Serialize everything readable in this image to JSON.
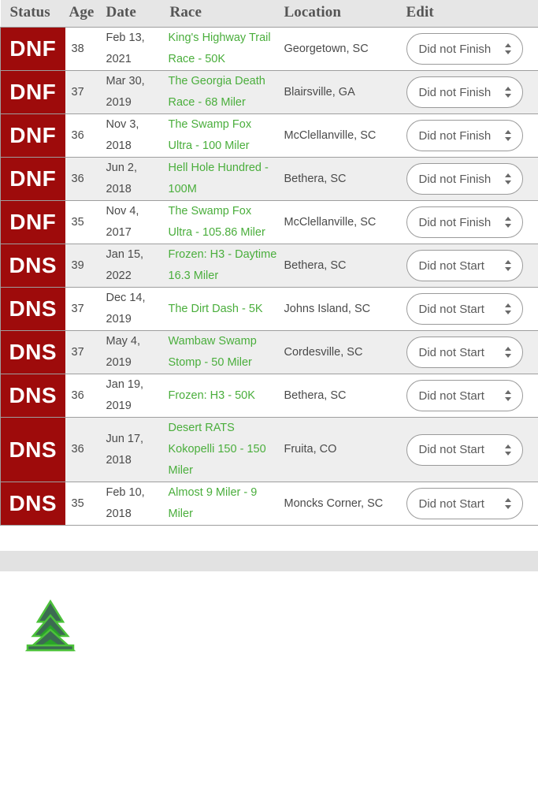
{
  "table": {
    "columns": [
      "Status",
      "Age",
      "Date",
      "Race",
      "Location",
      "Edit"
    ],
    "rows": [
      {
        "status": "DNF",
        "age": "38",
        "date_line1": "Feb 13,",
        "date_line2": "2021",
        "race": "King's Highway Trail Race - 50K",
        "location": "Georgetown, SC",
        "edit_value": "Did not Finish"
      },
      {
        "status": "DNF",
        "age": "37",
        "date_line1": "Mar 30,",
        "date_line2": "2019",
        "race": "The Georgia Death Race - 68 Miler",
        "location": "Blairsville, GA",
        "edit_value": "Did not Finish"
      },
      {
        "status": "DNF",
        "age": "36",
        "date_line1": "Nov 3,",
        "date_line2": "2018",
        "race": "The Swamp Fox Ultra - 100 Miler",
        "location": "McClellanville, SC",
        "edit_value": "Did not Finish"
      },
      {
        "status": "DNF",
        "age": "36",
        "date_line1": "Jun 2,",
        "date_line2": "2018",
        "race": "Hell Hole Hundred - 100M",
        "location": "Bethera, SC",
        "edit_value": "Did not Finish"
      },
      {
        "status": "DNF",
        "age": "35",
        "date_line1": "Nov 4,",
        "date_line2": "2017",
        "race": "The Swamp Fox Ultra - 105.86 Miler",
        "location": "McClellanville, SC",
        "edit_value": "Did not Finish"
      },
      {
        "status": "DNS",
        "age": "39",
        "date_line1": "Jan 15,",
        "date_line2": "2022",
        "race": "Frozen: H3 - Daytime 16.3 Miler",
        "location": "Bethera, SC",
        "edit_value": "Did not Start"
      },
      {
        "status": "DNS",
        "age": "37",
        "date_line1": "Dec 14,",
        "date_line2": "2019",
        "race": "The Dirt Dash - 5K",
        "location": "Johns Island, SC",
        "edit_value": "Did not Start"
      },
      {
        "status": "DNS",
        "age": "37",
        "date_line1": "May 4,",
        "date_line2": "2019",
        "race": "Wambaw Swamp Stomp - 50 Miler",
        "location": "Cordesville, SC",
        "edit_value": "Did not Start"
      },
      {
        "status": "DNS",
        "age": "36",
        "date_line1": "Jan 19,",
        "date_line2": "2019",
        "race": "Frozen: H3 - 50K",
        "location": "Bethera, SC",
        "edit_value": "Did not Start"
      },
      {
        "status": "DNS",
        "age": "36",
        "date_line1": "Jun 17,",
        "date_line2": "2018",
        "race": "Desert RATS Kokopelli 150 - 150 Miler",
        "location": "Fruita, CO",
        "edit_value": "Did not Start"
      },
      {
        "status": "DNS",
        "age": "35",
        "date_line1": "Feb 10,",
        "date_line2": "2018",
        "race": "Almost 9 Miler - 9 Miler",
        "location": "Moncks Corner, SC",
        "edit_value": "Did not Start"
      }
    ]
  },
  "footer": {
    "logo_name": "pine-tree-logo"
  },
  "colors": {
    "status_red": "#9e0b0b",
    "race_link_green": "#4aae3c",
    "header_bg": "#e6e6e6",
    "alt_row_bg": "#eeeeee",
    "band_gray": "#e2e2e2",
    "logo_dark_green": "#3c6b52",
    "logo_bright_green": "#29a329"
  }
}
